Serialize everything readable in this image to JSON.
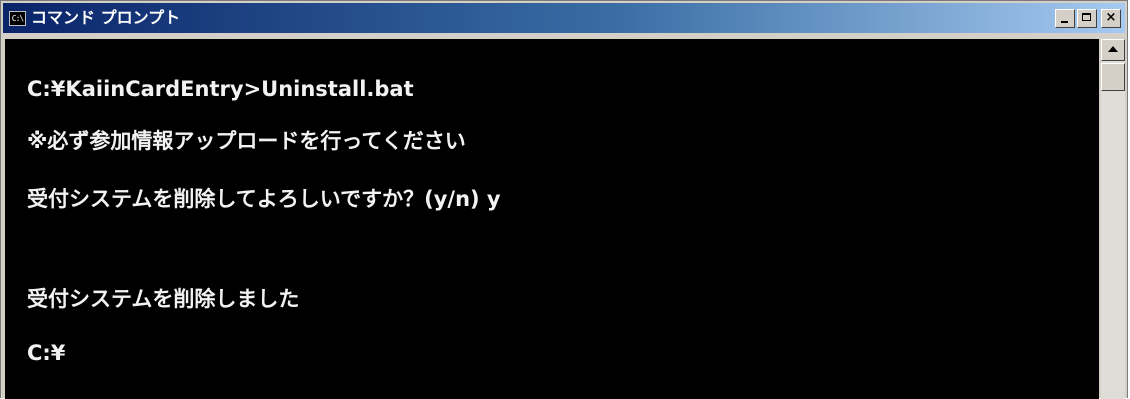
{
  "window": {
    "title": "コマンド プロンプト",
    "icon_label": "C:\\",
    "icon_name": "console-app-icon",
    "controls": {
      "minimize_icon": "minimize-icon",
      "maximize_icon": "maximize-icon",
      "close_label": "×"
    }
  },
  "console": {
    "lines": [
      "C:¥KaiinCardEntry>Uninstall.bat",
      "※必ず参加情報アップロードを行ってください",
      "受付システムを削除してよろしいですか？(y/n) y",
      "受付システムを削除しました",
      "C:¥"
    ],
    "text_color": "#f2f2f2",
    "background_color": "#000000"
  },
  "colors": {
    "titlebar_start": "#0a246a",
    "titlebar_end": "#a6caf0",
    "chrome": "#d4d0c8"
  }
}
